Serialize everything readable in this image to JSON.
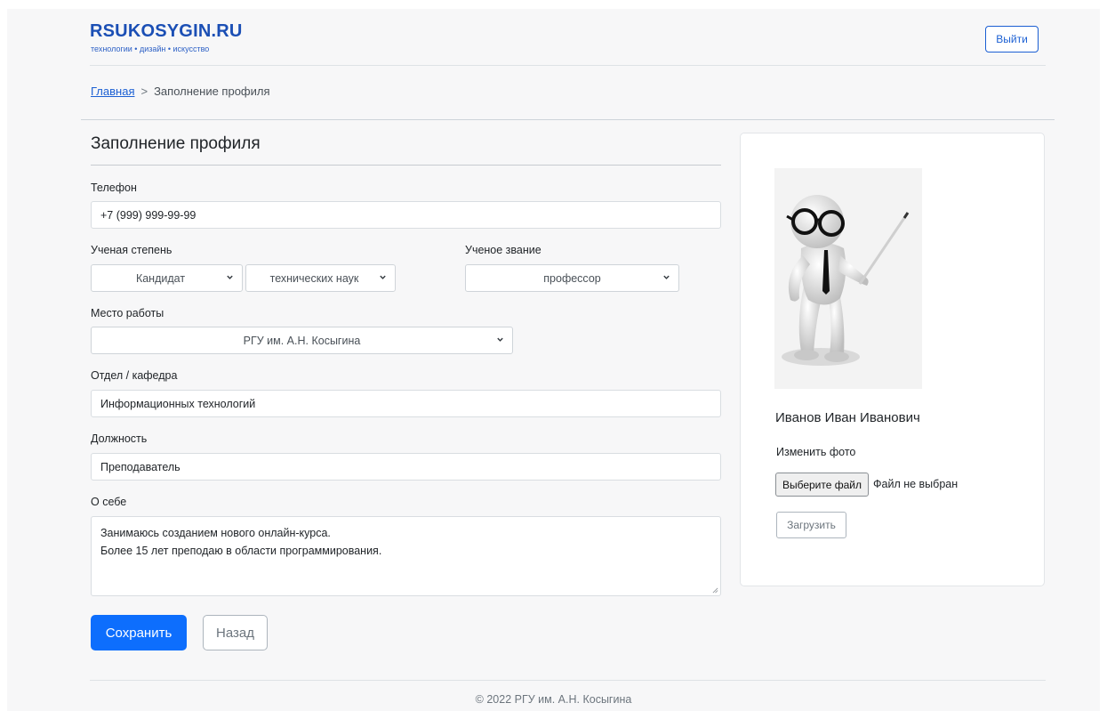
{
  "header": {
    "logo_title": "RSUKOSYGIN.RU",
    "logo_subtitle": "технологии • дизайн • искусство",
    "logout_label": "Выйти"
  },
  "breadcrumb": {
    "home": "Главная",
    "separator": ">",
    "current": "Заполнение профиля"
  },
  "form": {
    "title": "Заполнение профиля",
    "phone_label": "Телефон",
    "phone_value": "+7 (999) 999-99-99",
    "degree_label": "Ученая степень",
    "degree_level": "Кандидат",
    "degree_field": "технических наук",
    "title_rank_label": "Ученое звание",
    "title_rank_value": "профессор",
    "workplace_label": "Место работы",
    "workplace_value": "РГУ им. А.Н. Косыгина",
    "department_label": "Отдел / кафедра",
    "department_value": "Информационных технологий",
    "position_label": "Должность",
    "position_value": "Преподаватель",
    "about_label": "О себе",
    "about_line1": "Занимаюсь созданием нового онлайн-курса.",
    "about_line2": "Более 15 лет преподаю в области программирования.",
    "save_label": "Сохранить",
    "back_label": "Назад"
  },
  "profile_card": {
    "name": "Иванов Иван Иванович",
    "change_photo_label": "Изменить фото",
    "file_button_label": "Выберите файл",
    "file_status": "Файл не выбран",
    "upload_label": "Загрузить"
  },
  "footer": {
    "copyright": "© 2022 РГУ им. А.Н. Косыгина"
  },
  "colors": {
    "primary": "#0d6efd",
    "logo": "#1b4fb5"
  },
  "icons": [
    "chevron-down-icon",
    "resize-handle-icon",
    "teacher-avatar"
  ]
}
